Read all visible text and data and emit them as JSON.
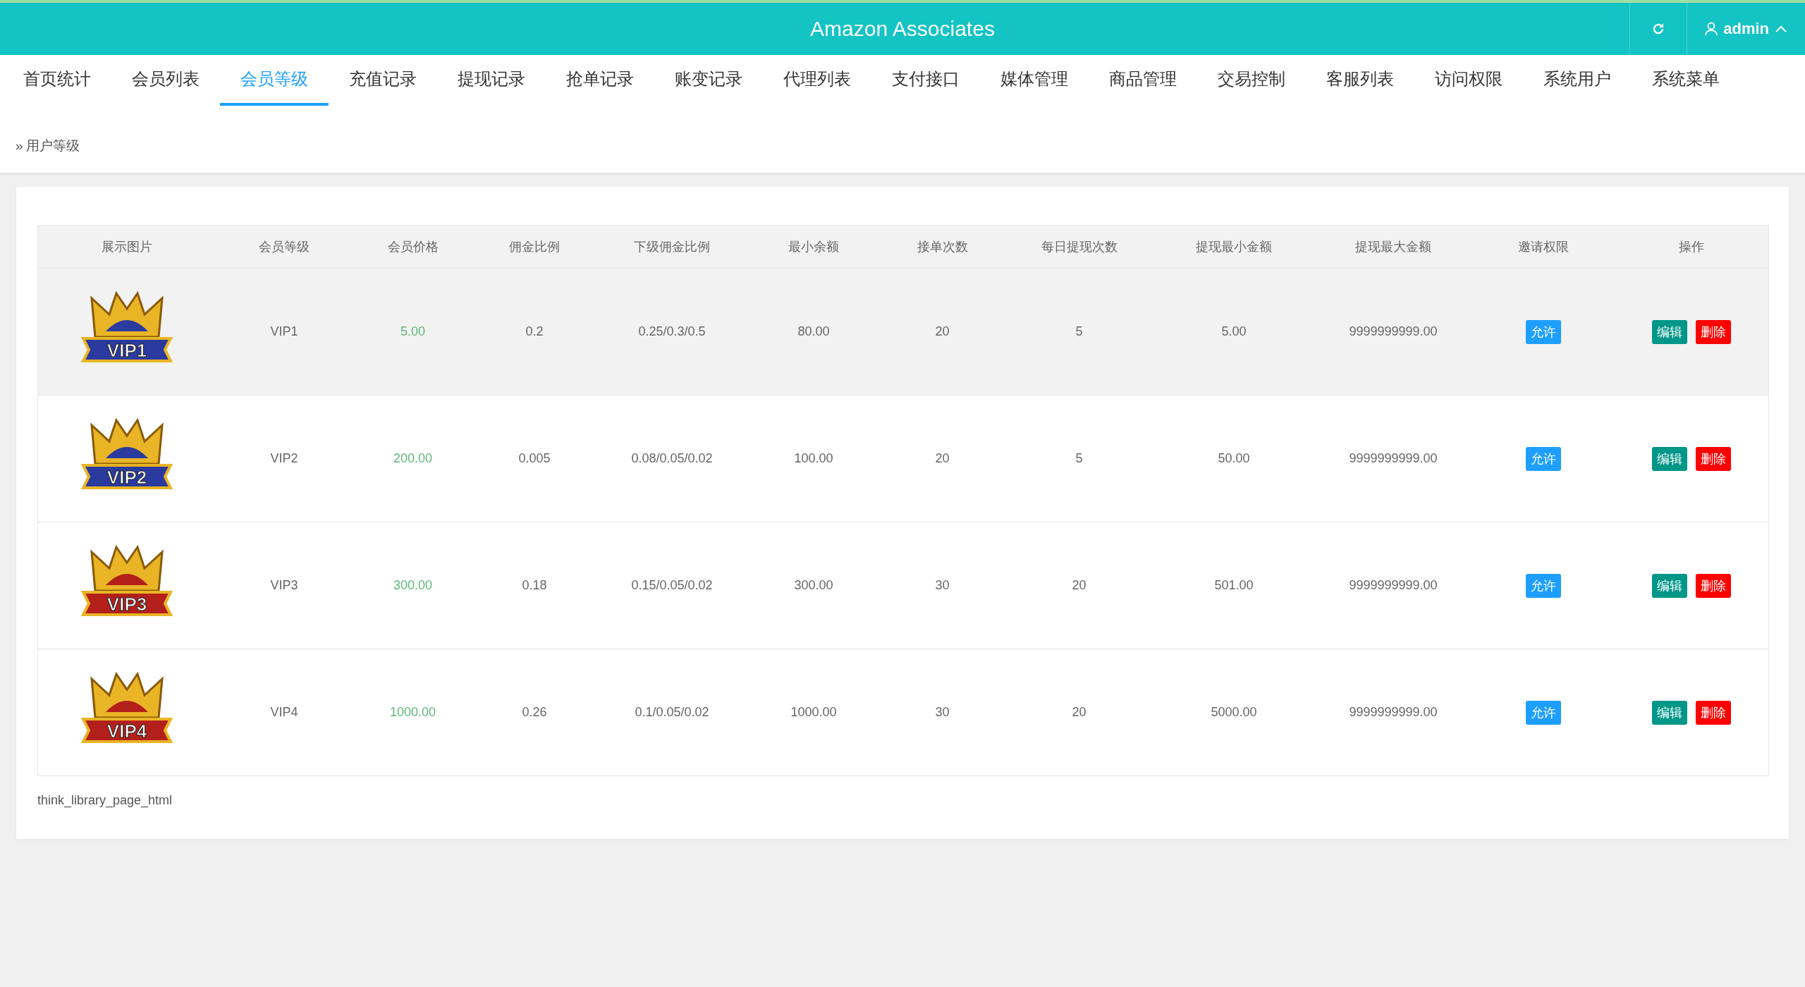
{
  "header": {
    "title": "Amazon Associates",
    "user": "admin"
  },
  "nav": [
    {
      "label": "首页统计",
      "selected": false
    },
    {
      "label": "会员列表",
      "selected": false
    },
    {
      "label": "会员等级",
      "selected": true
    },
    {
      "label": "充值记录",
      "selected": false
    },
    {
      "label": "提现记录",
      "selected": false
    },
    {
      "label": "抢单记录",
      "selected": false
    },
    {
      "label": "账变记录",
      "selected": false
    },
    {
      "label": "代理列表",
      "selected": false
    },
    {
      "label": "支付接口",
      "selected": false
    },
    {
      "label": "媒体管理",
      "selected": false
    },
    {
      "label": "商品管理",
      "selected": false
    },
    {
      "label": "交易控制",
      "selected": false
    },
    {
      "label": "客服列表",
      "selected": false
    },
    {
      "label": "访问权限",
      "selected": false
    },
    {
      "label": "系统用户",
      "selected": false
    },
    {
      "label": "系统菜单",
      "selected": false
    }
  ],
  "breadcrumb": {
    "separator": "»",
    "label": "用户等级"
  },
  "table": {
    "columns": [
      "展示图片",
      "会员等级",
      "会员价格",
      "佣金比例",
      "下级佣金比例",
      "最小余额",
      "接单次数",
      "每日提现次数",
      "提现最小金额",
      "提现最大金额",
      "邀请权限",
      "操作"
    ],
    "rows": [
      {
        "highlighted": true,
        "color": "#2b3a9e",
        "cells": [
          "VIP1",
          "VIP1",
          "5.00",
          "0.2",
          "0.25/0.3/0.5",
          "80.00",
          "20",
          "5",
          "5.00",
          "9999999999.00"
        ],
        "invite": "允许",
        "actions": [
          {
            "kind": "edit",
            "label": "编辑"
          },
          {
            "kind": "delete",
            "label": "删除"
          }
        ]
      },
      {
        "highlighted": false,
        "color": "#2b3a9e",
        "cells": [
          "VIP2",
          "VIP2",
          "200.00",
          "0.005",
          "0.08/0.05/0.02",
          "100.00",
          "20",
          "5",
          "50.00",
          "9999999999.00"
        ],
        "invite": "允许",
        "actions": [
          {
            "kind": "edit",
            "label": "编辑"
          },
          {
            "kind": "delete",
            "label": "删除"
          }
        ]
      },
      {
        "highlighted": false,
        "color": "#b3201b",
        "cells": [
          "VIP3",
          "VIP3",
          "300.00",
          "0.18",
          "0.15/0.05/0.02",
          "300.00",
          "30",
          "20",
          "501.00",
          "9999999999.00"
        ],
        "invite": "允许",
        "actions": [
          {
            "kind": "edit",
            "label": "编辑"
          },
          {
            "kind": "delete",
            "label": "删除"
          }
        ]
      },
      {
        "highlighted": false,
        "color": "#b3201b",
        "cells": [
          "VIP4",
          "VIP4",
          "1000.00",
          "0.26",
          "0.1/0.05/0.02",
          "1000.00",
          "30",
          "20",
          "5000.00",
          "9999999999.00"
        ],
        "invite": "允许",
        "actions": [
          {
            "kind": "edit",
            "label": "编辑"
          },
          {
            "kind": "delete",
            "label": "删除"
          }
        ]
      }
    ]
  },
  "footer_text": "think_library_page_html"
}
